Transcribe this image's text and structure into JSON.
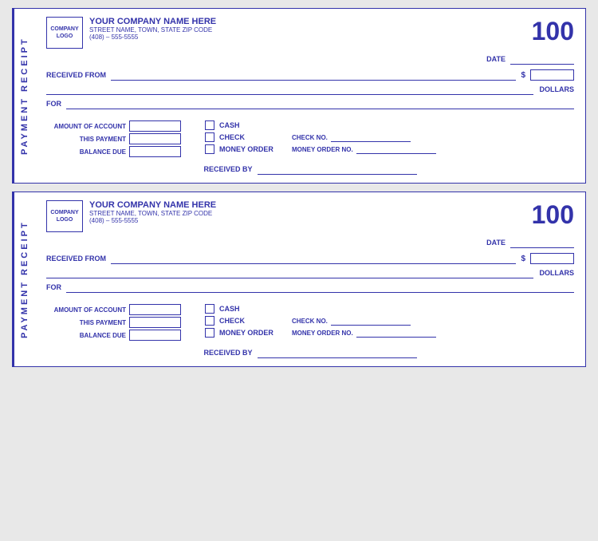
{
  "receipt": {
    "logo_line1": "COMPANY",
    "logo_line2": "LOGO",
    "company_name": "YOUR COMPANY NAME HERE",
    "company_address": "STREET NAME, TOWN, STATE  ZIP CODE",
    "company_phone": "(408) – 555-5555",
    "receipt_number": "100",
    "side_label": "PAYMENT RECEIPT",
    "date_label": "DATE",
    "received_from_label": "RECEIVED FROM",
    "dollar_sign": "$",
    "dollars_label": "DOLLARS",
    "for_label": "FOR",
    "amount_of_account_label": "AMOUNT OF ACCOUNT",
    "this_payment_label": "THIS PAYMENT",
    "balance_due_label": "BALANCE DUE",
    "cash_label": "CASH",
    "check_label": "CHECK",
    "money_order_label": "MONEY ORDER",
    "check_no_label": "CHECK NO.",
    "money_order_no_label": "MONEY ORDER NO.",
    "received_by_label": "RECEIVED BY"
  }
}
